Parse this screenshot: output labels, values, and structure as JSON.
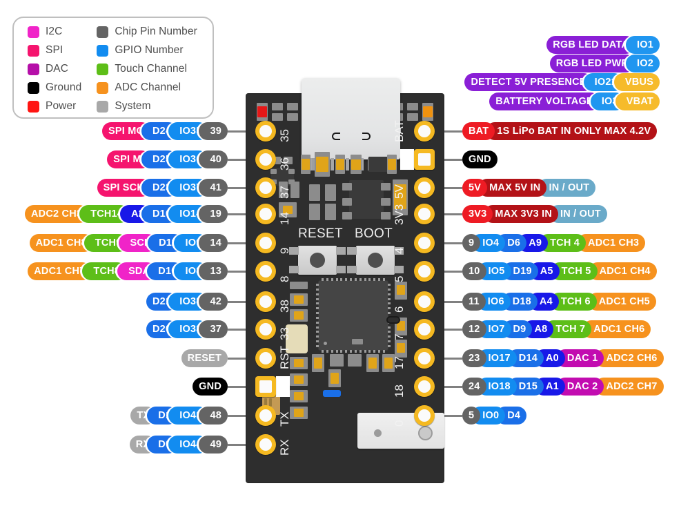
{
  "legend": {
    "left": [
      {
        "label": "I2C",
        "color": "#f024c8"
      },
      {
        "label": "SPI",
        "color": "#f5146e"
      },
      {
        "label": "DAC",
        "color": "#b50fa8"
      },
      {
        "label": "Ground",
        "color": "#000000"
      },
      {
        "label": "Power",
        "color": "#ff1512"
      }
    ],
    "right": [
      {
        "label": "Chip Pin Number",
        "color": "#646464"
      },
      {
        "label": "GPIO Number",
        "color": "#128cf0"
      },
      {
        "label": "Touch Channel",
        "color": "#5dbe18"
      },
      {
        "label": "ADC Channel",
        "color": "#f6921e"
      },
      {
        "label": "System",
        "color": "#a8a8a8"
      }
    ]
  },
  "top_right_notes": [
    {
      "pills": [
        {
          "t": "RGB LED DATA",
          "c": "#8a1fd6"
        },
        {
          "t": "IO1",
          "c": "#2096f0"
        }
      ]
    },
    {
      "pills": [
        {
          "t": "RGB LED PWR",
          "c": "#8a1fd6"
        },
        {
          "t": "IO2",
          "c": "#2096f0"
        }
      ]
    },
    {
      "pills": [
        {
          "t": "DETECT 5V PRESENCE",
          "c": "#8a1fd6"
        },
        {
          "t": "IO21",
          "c": "#2096f0"
        },
        {
          "t": "VBUS",
          "c": "#f6bb2b"
        }
      ]
    },
    {
      "pills": [
        {
          "t": "BATTERY VOLTAGE",
          "c": "#8a1fd6"
        },
        {
          "t": "IO3",
          "c": "#2096f0"
        },
        {
          "t": "VBAT",
          "c": "#f6bb2b"
        }
      ]
    }
  ],
  "left_rows": [
    {
      "pills": [
        {
          "t": "SPI MO",
          "c": "#f5146e"
        },
        {
          "t": "D24",
          "c": "#1a6fe8"
        },
        {
          "t": "IO35",
          "c": "#128cf0"
        },
        {
          "t": "39",
          "c": "#646464"
        }
      ]
    },
    {
      "pills": [
        {
          "t": "SPI MI",
          "c": "#f5146e"
        },
        {
          "t": "D25",
          "c": "#1a6fe8"
        },
        {
          "t": "IO36",
          "c": "#128cf0"
        },
        {
          "t": "40",
          "c": "#646464"
        }
      ]
    },
    {
      "pills": [
        {
          "t": "SPI SCK",
          "c": "#f5146e"
        },
        {
          "t": "D23",
          "c": "#1a6fe8"
        },
        {
          "t": "IO37",
          "c": "#128cf0"
        },
        {
          "t": "41",
          "c": "#646464"
        }
      ]
    },
    {
      "pills": [
        {
          "t": "ADC2 CH3",
          "c": "#f6921e"
        },
        {
          "t": "TCH14",
          "c": "#5dbe18"
        },
        {
          "t": "A2",
          "c": "#1818e8"
        },
        {
          "t": "D16",
          "c": "#1a6fe8"
        },
        {
          "t": "IO14",
          "c": "#128cf0"
        },
        {
          "t": "19",
          "c": "#646464"
        }
      ]
    },
    {
      "pills": [
        {
          "t": "ADC1 CH8",
          "c": "#f6921e"
        },
        {
          "t": "TCH9",
          "c": "#5dbe18"
        },
        {
          "t": "SCL",
          "c": "#f024c8"
        },
        {
          "t": "D11",
          "c": "#1a6fe8"
        },
        {
          "t": "IO9",
          "c": "#128cf0"
        },
        {
          "t": "14",
          "c": "#646464"
        }
      ]
    },
    {
      "pills": [
        {
          "t": "ADC1 CH7",
          "c": "#f6921e"
        },
        {
          "t": "TCH8",
          "c": "#5dbe18"
        },
        {
          "t": "SDA",
          "c": "#f024c8"
        },
        {
          "t": "D10",
          "c": "#1a6fe8"
        },
        {
          "t": "IO8",
          "c": "#128cf0"
        },
        {
          "t": "13",
          "c": "#646464"
        }
      ]
    },
    {
      "pills": [
        {
          "t": "D21",
          "c": "#1a6fe8"
        },
        {
          "t": "IO38",
          "c": "#128cf0"
        },
        {
          "t": "42",
          "c": "#646464"
        }
      ]
    },
    {
      "pills": [
        {
          "t": "D20",
          "c": "#1a6fe8"
        },
        {
          "t": "IO33",
          "c": "#128cf0"
        },
        {
          "t": "37",
          "c": "#646464"
        }
      ]
    },
    {
      "pills": [
        {
          "t": "RESET",
          "c": "#a8a8a8"
        }
      ]
    },
    {
      "pills": [
        {
          "t": "GND",
          "c": "#000000"
        }
      ]
    },
    {
      "pills": [
        {
          "t": "TX",
          "c": "#a8a8a8"
        },
        {
          "t": "D1",
          "c": "#1a6fe8"
        },
        {
          "t": "IO43",
          "c": "#128cf0"
        },
        {
          "t": "48",
          "c": "#646464"
        }
      ]
    },
    {
      "pills": [
        {
          "t": "RX",
          "c": "#a8a8a8"
        },
        {
          "t": "D0",
          "c": "#1a6fe8"
        },
        {
          "t": "IO44",
          "c": "#128cf0"
        },
        {
          "t": "49",
          "c": "#646464"
        }
      ]
    }
  ],
  "right_rows": [
    {
      "pills": [
        {
          "t": "BAT",
          "c": "#ee1b24"
        },
        {
          "t": "1S LiPo BAT IN ONLY MAX 4.2V",
          "c": "#b31217"
        }
      ]
    },
    {
      "pills": [
        {
          "t": "GND",
          "c": "#000000"
        }
      ]
    },
    {
      "pills": [
        {
          "t": "5V",
          "c": "#ee1b24"
        },
        {
          "t": "MAX 5V IN",
          "c": "#b31217"
        },
        {
          "t": "IN / OUT",
          "c": "#6aaac9"
        }
      ]
    },
    {
      "pills": [
        {
          "t": "3V3",
          "c": "#ee1b24"
        },
        {
          "t": "MAX 3V3 IN",
          "c": "#b31217"
        },
        {
          "t": "IN / OUT",
          "c": "#6aaac9"
        }
      ]
    },
    {
      "pills": [
        {
          "t": "9",
          "c": "#646464"
        },
        {
          "t": "IO4",
          "c": "#128cf0"
        },
        {
          "t": "D6",
          "c": "#1a6fe8"
        },
        {
          "t": "A9",
          "c": "#1818e8"
        },
        {
          "t": "TCH 4",
          "c": "#5dbe18"
        },
        {
          "t": "ADC1 CH3",
          "c": "#f6921e"
        }
      ]
    },
    {
      "pills": [
        {
          "t": "10",
          "c": "#646464"
        },
        {
          "t": "IO5",
          "c": "#128cf0"
        },
        {
          "t": "D19",
          "c": "#1a6fe8"
        },
        {
          "t": "A5",
          "c": "#1818e8"
        },
        {
          "t": "TCH 5",
          "c": "#5dbe18"
        },
        {
          "t": "ADC1 CH4",
          "c": "#f6921e"
        }
      ]
    },
    {
      "pills": [
        {
          "t": "11",
          "c": "#646464"
        },
        {
          "t": "IO6",
          "c": "#128cf0"
        },
        {
          "t": "D18",
          "c": "#1a6fe8"
        },
        {
          "t": "A4",
          "c": "#1818e8"
        },
        {
          "t": "TCH 6",
          "c": "#5dbe18"
        },
        {
          "t": "ADC1 CH5",
          "c": "#f6921e"
        }
      ]
    },
    {
      "pills": [
        {
          "t": "12",
          "c": "#646464"
        },
        {
          "t": "IO7",
          "c": "#128cf0"
        },
        {
          "t": "D9",
          "c": "#1a6fe8"
        },
        {
          "t": "A8",
          "c": "#1818e8"
        },
        {
          "t": "TCH 7",
          "c": "#5dbe18"
        },
        {
          "t": "ADC1 CH6",
          "c": "#f6921e"
        }
      ]
    },
    {
      "pills": [
        {
          "t": "23",
          "c": "#646464"
        },
        {
          "t": "IO17",
          "c": "#128cf0"
        },
        {
          "t": "D14",
          "c": "#1a6fe8"
        },
        {
          "t": "A0",
          "c": "#1818e8"
        },
        {
          "t": "DAC 1",
          "c": "#c20cb0"
        },
        {
          "t": "ADC2 CH6",
          "c": "#f6921e"
        }
      ]
    },
    {
      "pills": [
        {
          "t": "24",
          "c": "#646464"
        },
        {
          "t": "IO18",
          "c": "#128cf0"
        },
        {
          "t": "D15",
          "c": "#1a6fe8"
        },
        {
          "t": "A1",
          "c": "#1818e8"
        },
        {
          "t": "DAC 2",
          "c": "#c20cb0"
        },
        {
          "t": "ADC2 CH7",
          "c": "#f6921e"
        }
      ]
    },
    {
      "pills": [
        {
          "t": "5",
          "c": "#646464"
        },
        {
          "t": "IO0",
          "c": "#128cf0"
        },
        {
          "t": "D4",
          "c": "#1a6fe8"
        }
      ]
    }
  ],
  "board": {
    "left_pad_labels": [
      "35",
      "36",
      "37",
      "14",
      "9",
      "8",
      "38",
      "33",
      "RST",
      "",
      "TX",
      "RX"
    ],
    "right_pad_labels": [
      "BAT",
      "",
      "5V",
      "3V3",
      "4",
      "5",
      "6",
      "7",
      "17",
      "18",
      "0"
    ],
    "buttons": [
      {
        "label": "RESET"
      },
      {
        "label": "BOOT"
      }
    ],
    "pcb_color": "#2e2e2e",
    "pad_color": "#f5b921"
  }
}
